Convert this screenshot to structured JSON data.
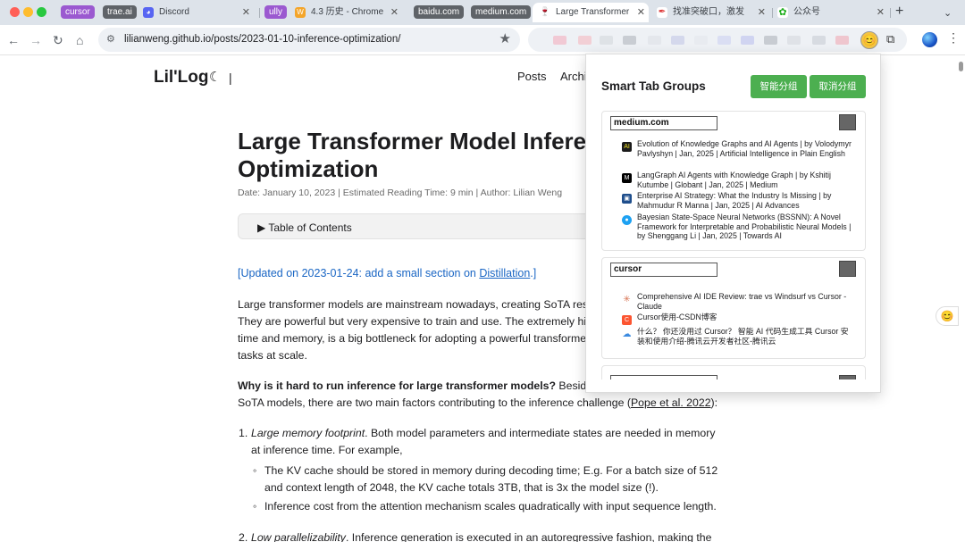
{
  "tabs": {
    "groups": [
      {
        "label": "cursor",
        "color": "#9b59d0"
      },
      {
        "label": "trae.ai",
        "color": "#5f6368"
      },
      {
        "label": "ully",
        "color": "#9b59d0"
      },
      {
        "label": "baidu.com",
        "color": "#5f6368"
      },
      {
        "label": "medium.com",
        "color": "#5f6368"
      }
    ],
    "items": [
      {
        "title": "Discord"
      },
      {
        "title": "4.3 历史 - Chrome"
      },
      {
        "title": "Large Transformer"
      },
      {
        "title": "找准突破口，激发"
      },
      {
        "title": "公众号"
      }
    ]
  },
  "toolbar": {
    "url": "lilianweng.github.io/posts/2023-01-10-inference-optimization/"
  },
  "site": {
    "logo": "Lil'Log",
    "separator": "|",
    "menu": [
      "Posts",
      "Archi"
    ]
  },
  "article": {
    "title": "Large Transformer Model Infere Optimization",
    "meta": "Date: January 10, 2023 | Estimated Reading Time: 9 min | Author: Lilian Weng",
    "toc_label": "▶ Table of Contents",
    "update_prefix": "[Updated on 2023-01-24: add a small section on ",
    "update_link": "Distillation",
    "update_suffix": ".]",
    "p1_lines": [
      "Large transformer models are mainstream nowadays, creating SoTA resu",
      "They are powerful but very expensive to train and use. The extremely hig",
      "time and memory, is a big bottleneck for adopting a powerful transforme",
      "tasks at scale."
    ],
    "p2_bold": "Why is it hard to run inference for large transformer models?",
    "p2_rest1": " Besides",
    "p2_line2_prefix": "SoTA models, there are two main factors contributing to the inference challenge (",
    "p2_link": "Pope et al. 2022",
    "p2_line2_suffix": "):",
    "l1_num": "1.",
    "l1_em": "Large memory footprint",
    "l1_rest": ". Both model parameters and intermediate states are needed in memory",
    "l1_line2": "at inference time. For example,",
    "b1_line1": "The KV cache should be stored in memory during decoding time; E.g. For a batch size of 512",
    "b1_line2": "and context length of 2048, the KV cache totals 3TB, that is 3x the model size (!).",
    "b2": "Inference cost from the attention mechanism scales quadratically with input sequence length.",
    "l2_num": "2.",
    "l2_em": "Low parallelizability",
    "l2_rest": ". Inference generation is executed in an autoregressive fashion, making the"
  },
  "popup": {
    "title": "Smart Tab Groups",
    "btn_group": "智能分组",
    "btn_ungroup": "取消分组",
    "groups": [
      {
        "name": "medium.com",
        "items": [
          {
            "icon": "AI",
            "icon_color": "#1b1b1b",
            "text": "Evolution of Knowledge Graphs and AI Agents | by Volodymyr Pavlyshyn | Jan, 2025 | Artificial Intelligence in Plain English"
          },
          {
            "icon": "M",
            "icon_color": "#000000",
            "text": "LangGraph AI Agents with Knowledge Graph | by Kshitij Kutumbe | Globant | Jan, 2025 | Medium"
          },
          {
            "icon": "▣",
            "icon_color": "#1f4e8c",
            "text": "Enterprise AI Strategy: What the Industry Is Missing | by Mahmudur R Manna | Jan, 2025 | AI Advances"
          },
          {
            "icon": "●",
            "icon_color": "#1da1f2",
            "text": "Bayesian State-Space Neural Networks (BSSNN): A Novel Framework for Interpretable and Probabilistic Neural Models | by Shenggang Li | Jan, 2025 | Towards AI"
          }
        ]
      },
      {
        "name": "cursor",
        "items": [
          {
            "icon": "✳",
            "icon_color": "#d97757",
            "text": "Comprehensive AI IDE Review: trae vs Windsurf vs Cursor - Claude"
          },
          {
            "icon": "C",
            "icon_color": "#fc5531",
            "text": "Cursor使用-CSDN博客"
          },
          {
            "icon": "☁",
            "icon_color": "#3d8be0",
            "text": "什么？ 你还没用过 Cursor？ 智能 AI 代码生成工具 Cursor 安装和使用介绍-腾讯云开发者社区-腾讯云"
          }
        ]
      }
    ]
  }
}
